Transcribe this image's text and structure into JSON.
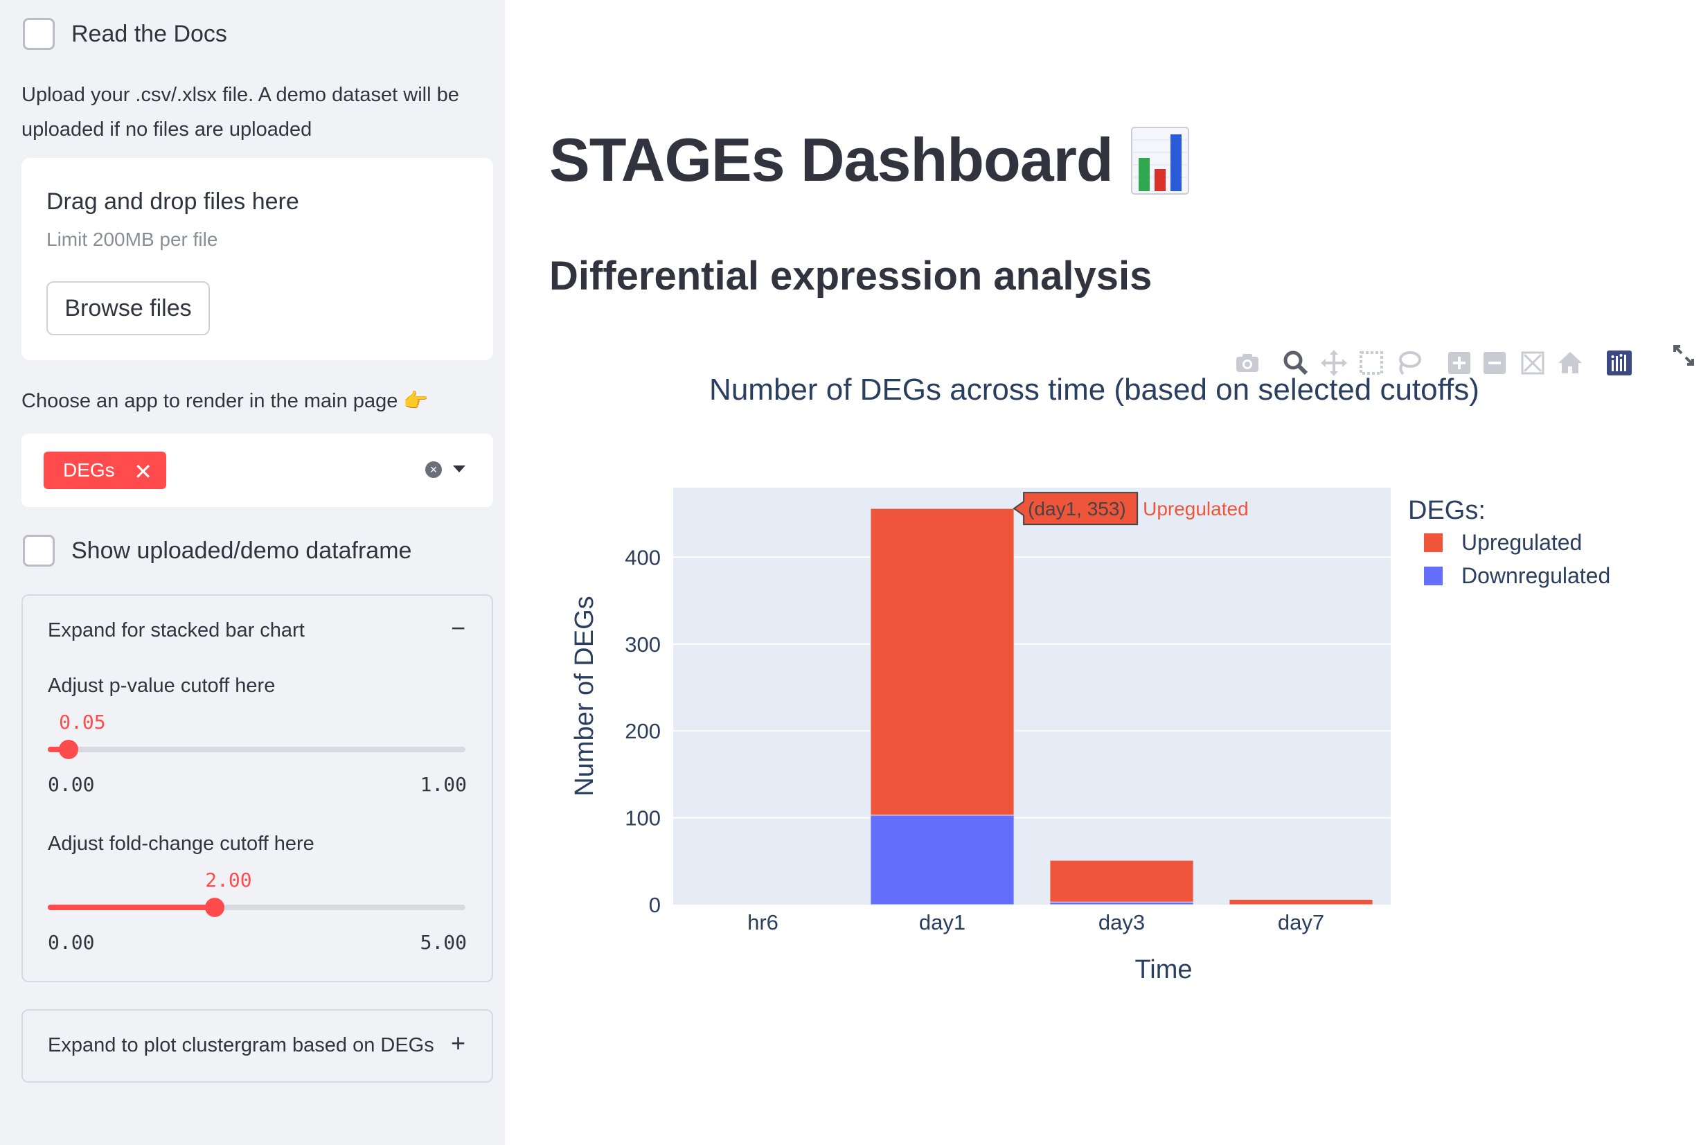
{
  "sidebar": {
    "read_docs_label": "Read the Docs",
    "upload_caption": "Upload your .csv/.xlsx file. A demo dataset will be uploaded if no files are uploaded",
    "dropzone": {
      "title": "Drag and drop files here",
      "limit": "Limit 200MB per file",
      "browse_label": "Browse files"
    },
    "choose_app_label": "Choose an app to render in the main page 👉",
    "selected_app": "DEGs",
    "show_dataframe_label": "Show uploaded/demo dataframe",
    "stacked_expander": {
      "title": "Expand for stacked bar chart",
      "toggle": "−",
      "pvalue": {
        "label": "Adjust p-value cutoff here",
        "value": "0.05",
        "min": "0.00",
        "max": "1.00",
        "fraction": 0.05
      },
      "foldchange": {
        "label": "Adjust fold-change cutoff here",
        "value": "2.00",
        "min": "0.00",
        "max": "5.00",
        "fraction": 0.4
      }
    },
    "clustergram_expander": {
      "title": "Expand to plot clustergram based on DEGs",
      "toggle": "+"
    }
  },
  "main": {
    "title": "STAGEs Dashboard",
    "section_title": "Differential expression analysis"
  },
  "modebar": {
    "icons": [
      "camera-icon",
      "zoom-icon",
      "pan-icon",
      "box-select-icon",
      "lasso-icon",
      "zoom-in-icon",
      "zoom-out-icon",
      "autoscale-icon",
      "home-icon",
      "plotly-logo-icon"
    ],
    "fullscreen_icon": "fullscreen-icon"
  },
  "chart_data": {
    "type": "bar",
    "barmode": "stack",
    "title": "Number of DEGs across time (based on selected cutoffs)",
    "xlabel": "Time",
    "ylabel": "Number of DEGs",
    "categories": [
      "hr6",
      "day1",
      "day3",
      "day7"
    ],
    "series": [
      {
        "name": "Downregulated",
        "color": "#636efa",
        "values": [
          0,
          103,
          3,
          0
        ]
      },
      {
        "name": "Upregulated",
        "color": "#ef553b",
        "values": [
          0,
          353,
          48,
          6
        ]
      }
    ],
    "ylim": [
      0,
      480
    ],
    "yticks": [
      0,
      100,
      200,
      300,
      400
    ],
    "legend_title": "DEGs:",
    "legend_order": [
      "Upregulated",
      "Downregulated"
    ],
    "legend_position": "top-right",
    "grid": true,
    "tooltip": {
      "label": "(day1, 353)",
      "series": "Upregulated"
    }
  }
}
